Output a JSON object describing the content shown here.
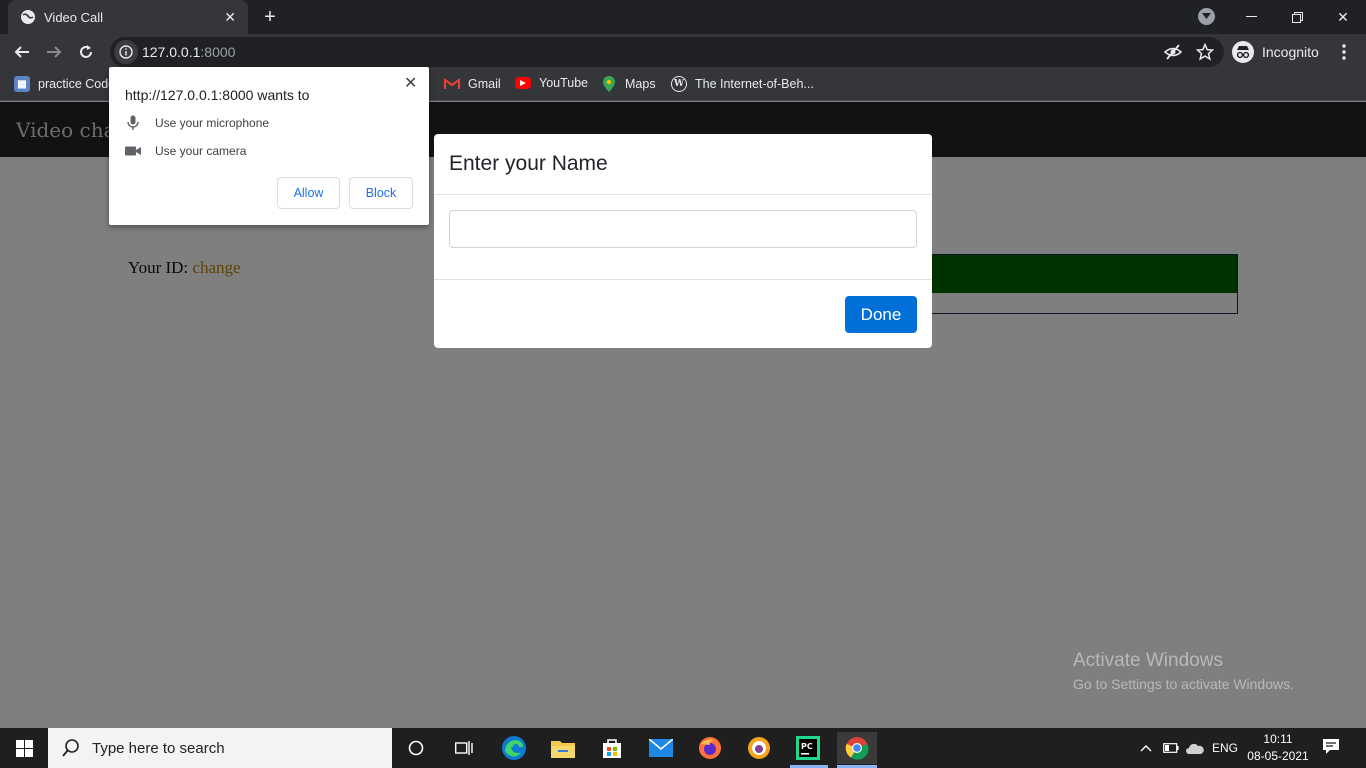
{
  "browser": {
    "tab_title": "Video Call",
    "url_host": "127.0.0.1",
    "url_port": ":8000",
    "incognito_label": "Incognito",
    "bookmarks": [
      {
        "label": "practice Code",
        "icon": "practice-icon"
      },
      {
        "label": "Gmail",
        "icon": "gmail-icon"
      },
      {
        "label": "YouTube",
        "icon": "youtube-icon"
      },
      {
        "label": "Maps",
        "icon": "maps-icon"
      },
      {
        "label": "The Internet-of-Beh...",
        "icon": "wordpress-icon"
      }
    ]
  },
  "permission_prompt": {
    "title": "http://127.0.0.1:8000 wants to",
    "microphone": "Use your microphone",
    "camera": "Use your camera",
    "allow": "Allow",
    "block": "Block"
  },
  "page": {
    "brand": "Video cha",
    "your_id_label": "Your ID:",
    "your_id_value": "change"
  },
  "modal": {
    "title": "Enter your Name",
    "input_value": "",
    "done_label": "Done"
  },
  "watermark": {
    "line1": "Activate Windows",
    "line2": "Go to Settings to activate Windows."
  },
  "taskbar": {
    "search_placeholder": "Type here to search",
    "language": "ENG",
    "time": "10:11",
    "date": "08-05-2021"
  },
  "colors": {
    "accent_button": "#0070d8",
    "chrome_dark": "#202124",
    "chrome_toolbar": "#35363a",
    "green_bar": "#006400",
    "id_value": "#b8860b"
  }
}
